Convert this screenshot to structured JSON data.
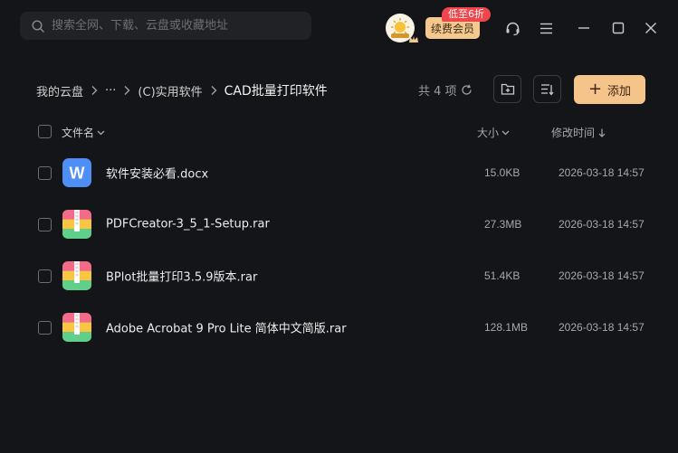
{
  "topbar": {
    "search_placeholder": "搜索全网、下载、云盘或收藏地址",
    "vip_label": "续费会员",
    "discount_badge": "低至6折"
  },
  "breadcrumb": {
    "root": "我的云盘",
    "more": "···",
    "parent": "(C)实用软件",
    "current": "CAD批量打印软件"
  },
  "toolbar": {
    "count_label": "共 4 项",
    "add_label": "添加"
  },
  "table": {
    "columns": {
      "name": "文件名",
      "size": "大小",
      "modified": "修改时间"
    },
    "rows": [
      {
        "name": "软件安装必看.docx",
        "size": "15.0KB",
        "modified": "2026-03-18 14:57",
        "icon": "word-doc-icon"
      },
      {
        "name": "PDFCreator-3_5_1-Setup.rar",
        "size": "27.3MB",
        "modified": "2026-03-18 14:57",
        "icon": "archive-icon"
      },
      {
        "name": "BPlot批量打印3.5.9版本.rar",
        "size": "51.4KB",
        "modified": "2026-03-18 14:57",
        "icon": "archive-icon"
      },
      {
        "name": "Adobe Acrobat 9 Pro Lite 简体中文简版.rar",
        "size": "128.1MB",
        "modified": "2026-03-18 14:57",
        "icon": "archive-icon"
      }
    ]
  },
  "colors": {
    "background": "#141518",
    "accent": "#f5c48a",
    "badge": "#f0454a",
    "word": "#4e8ef7"
  }
}
